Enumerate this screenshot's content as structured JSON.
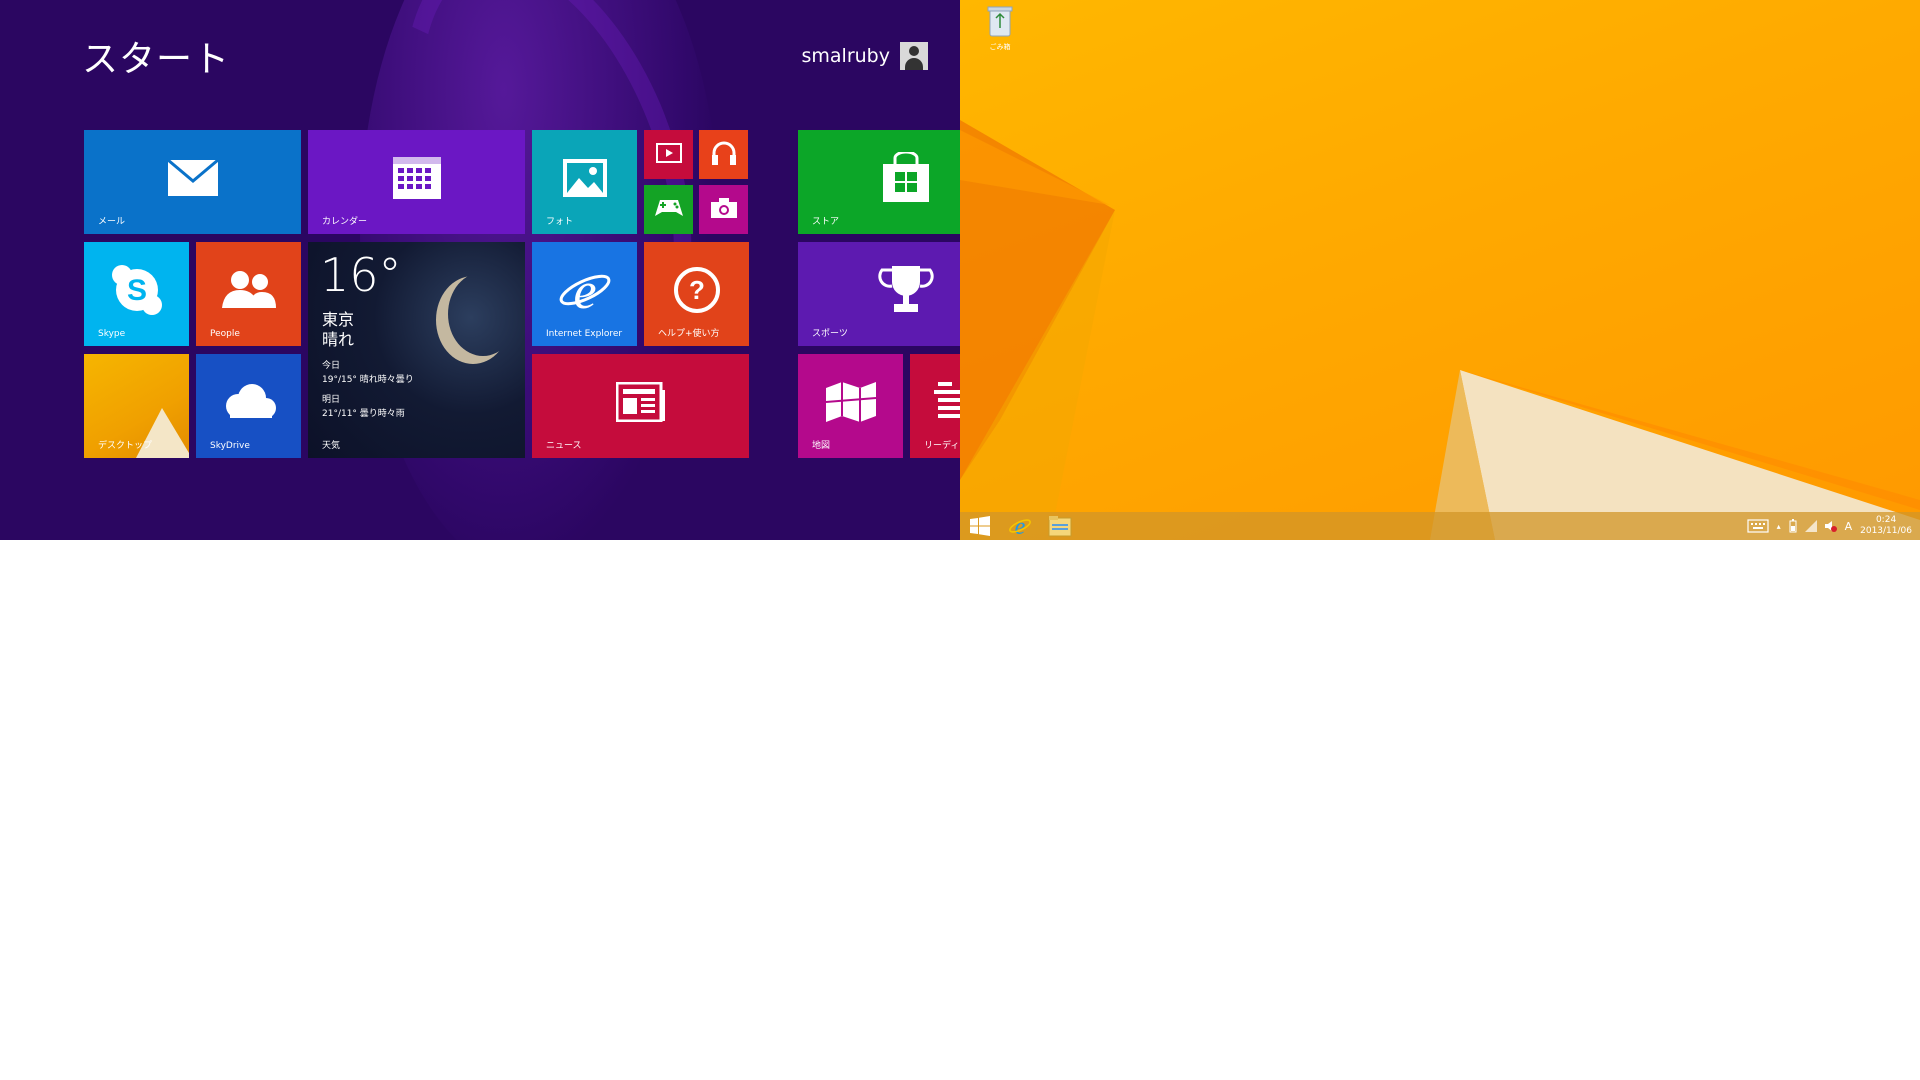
{
  "start": {
    "title": "スタート",
    "user": "smalruby",
    "background": "#2b0661",
    "tiles": {
      "mail": {
        "label": "メール",
        "color": "#0a72c9",
        "icon": "mail-icon"
      },
      "calendar": {
        "label": "カレンダー",
        "color": "#6b17c4",
        "icon": "calendar-icon"
      },
      "photos": {
        "label": "フォト",
        "color": "#0aa5b8",
        "icon": "photo-icon"
      },
      "video": {
        "label": "",
        "color": "#c50c3c",
        "icon": "video-icon"
      },
      "music": {
        "label": "",
        "color": "#e8411a",
        "icon": "headphones-icon"
      },
      "games": {
        "label": "",
        "color": "#14a325",
        "icon": "gamepad-icon"
      },
      "camera": {
        "label": "",
        "color": "#b4098c",
        "icon": "camera-icon"
      },
      "skype": {
        "label": "Skype",
        "color": "#00b4ef",
        "icon": "skype-icon"
      },
      "people": {
        "label": "People",
        "color": "#e1431a",
        "icon": "people-icon"
      },
      "weather": {
        "label": "天気",
        "temp": "16°",
        "city": "東京",
        "condition": "晴れ",
        "today_label": "今日",
        "today": "19°/15° 晴れ時々曇り",
        "tomorrow_label": "明日",
        "tomorrow": "21°/11° 曇り時々雨"
      },
      "ie": {
        "label": "Internet Explorer",
        "color": "#1874e3",
        "icon": "ie-icon"
      },
      "help": {
        "label": "ヘルプ+使い方",
        "color": "#e1431a",
        "icon": "help-icon"
      },
      "desktop": {
        "label": "デスクトップ",
        "color": "#f0a800"
      },
      "skydrive": {
        "label": "SkyDrive",
        "color": "#1750c4",
        "icon": "cloud-icon"
      },
      "news": {
        "label": "ニュース",
        "color": "#c50c3c",
        "icon": "news-icon"
      },
      "store": {
        "label": "ストア",
        "color": "#0ca628",
        "icon": "store-icon"
      },
      "sports": {
        "label": "スポーツ",
        "color": "#5d1ab0",
        "icon": "trophy-icon"
      },
      "maps": {
        "label": "地図",
        "color": "#b4098c",
        "icon": "map-icon"
      },
      "reading": {
        "label": "リーディング",
        "color": "#c50c3c",
        "icon": "reading-list-icon"
      }
    }
  },
  "desktop": {
    "recycle_bin_label": "ごみ箱",
    "taskbar": {
      "buttons": [
        "windows-logo-icon",
        "ie-icon",
        "file-explorer-icon"
      ],
      "ime_indicator": "A",
      "time": "0:24",
      "date": "2013/11/06"
    }
  }
}
